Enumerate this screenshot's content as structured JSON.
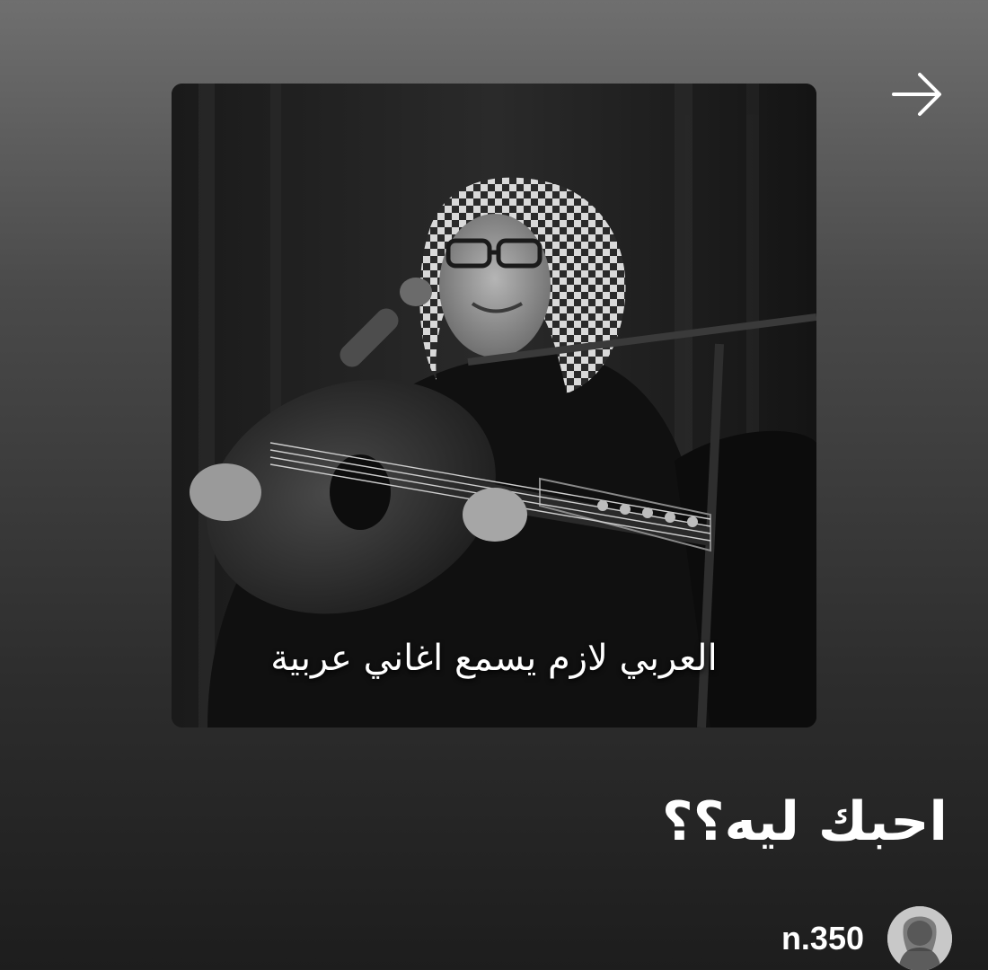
{
  "navigation": {
    "forward_icon": "arrow-right-icon"
  },
  "cover": {
    "caption": "العربي لازم يسمع اغاني عربية",
    "image": "oud-player-photo"
  },
  "playlist": {
    "title": "احبك ليه؟؟"
  },
  "creator": {
    "name": "n.350",
    "avatar_icon": "user-avatar"
  },
  "colors": {
    "background_top": "#6f6f6f",
    "background_bottom": "#1d1d1d",
    "text": "#ffffff"
  }
}
